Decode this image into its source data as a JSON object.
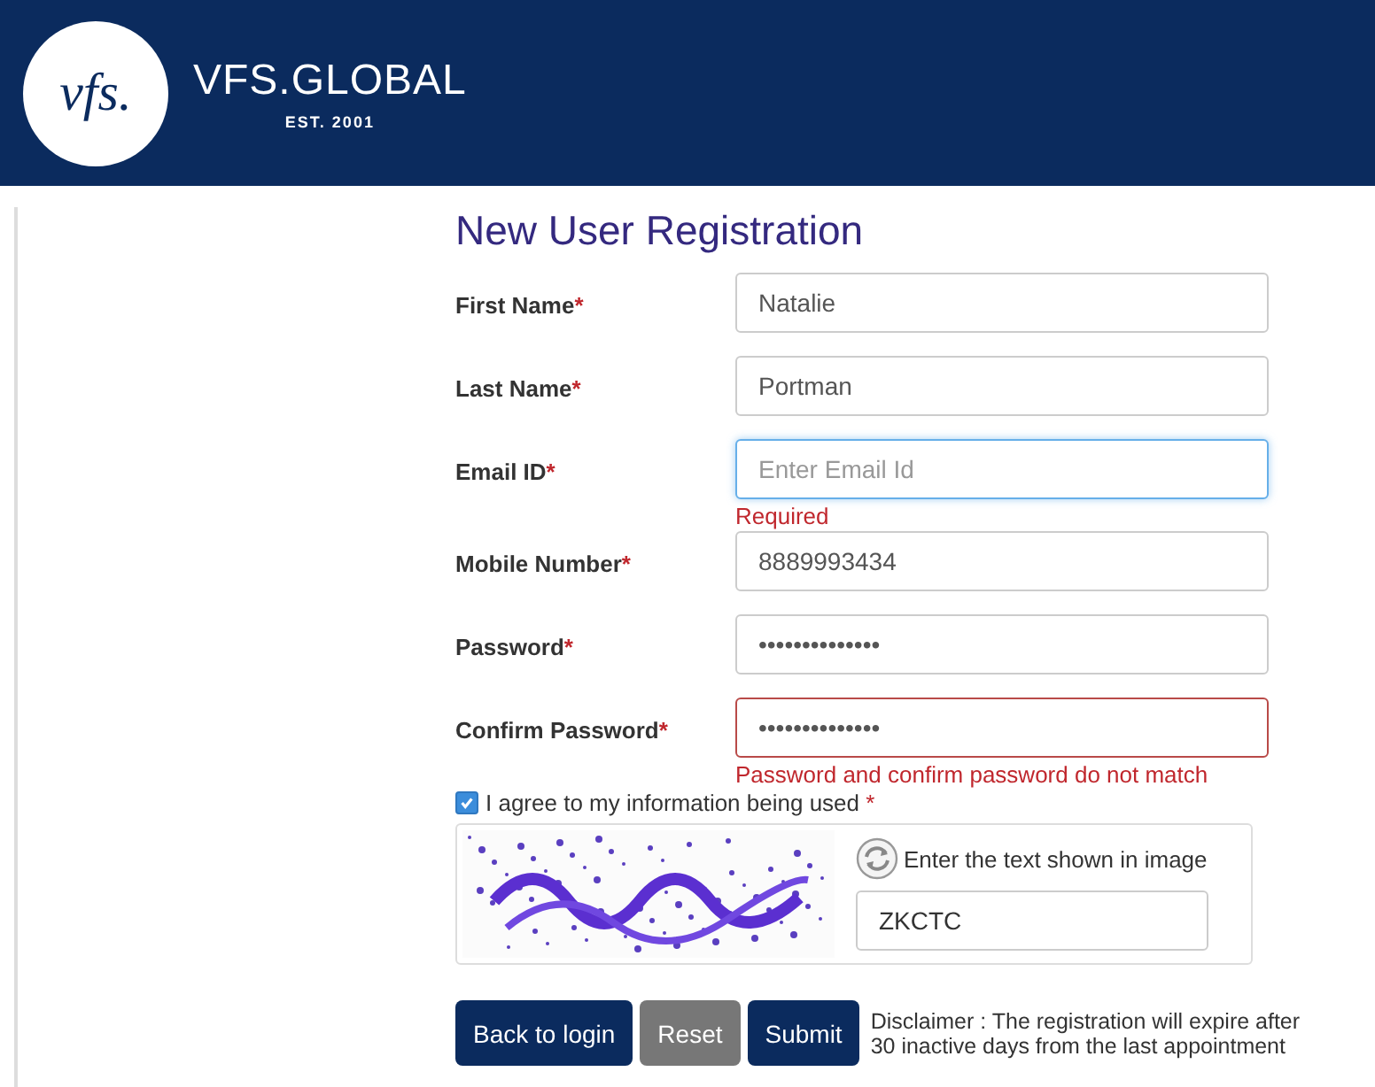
{
  "header": {
    "brand": "VFS.GLOBAL",
    "established": "EST. 2001",
    "logo_text": "vfs."
  },
  "title": "New User Registration",
  "fields": [
    {
      "label": "First Name",
      "required_mark": "*",
      "value": "Natalie",
      "focused": false,
      "invalid": false
    },
    {
      "label": "Last Name",
      "required_mark": "*",
      "value": "Portman",
      "focused": false,
      "invalid": false
    },
    {
      "label": "Email ID",
      "required_mark": "*",
      "placeholder": "Enter Email Id",
      "focused": true,
      "invalid": false,
      "error": "Required"
    },
    {
      "label": "Mobile Number",
      "required_mark": "*",
      "value": "8889993434",
      "focused": false,
      "invalid": false
    },
    {
      "label": "Password",
      "required_mark": "*",
      "value": "••••••••••••••",
      "focused": false,
      "invalid": false
    },
    {
      "label": "Confirm Password",
      "required_mark": "*",
      "value": "••••••••••••••",
      "focused": false,
      "invalid": true,
      "error": "Password and confirm password do not match"
    }
  ],
  "consent": {
    "label": "I agree to my information being used",
    "required_mark": "*",
    "checked": true
  },
  "captcha": {
    "kind": "picture",
    "prompt": "Enter the text shown in image",
    "value": "ZKCTC"
  },
  "buttons": [
    {
      "label": "Back to login",
      "kind": "primary"
    },
    {
      "label": "Reset",
      "kind": "secondary"
    },
    {
      "label": "Submit",
      "kind": "primary"
    }
  ],
  "disclaimer": [
    "Disclaimer : The registration will expire after",
    "30 inactive days from the last appointment"
  ]
}
